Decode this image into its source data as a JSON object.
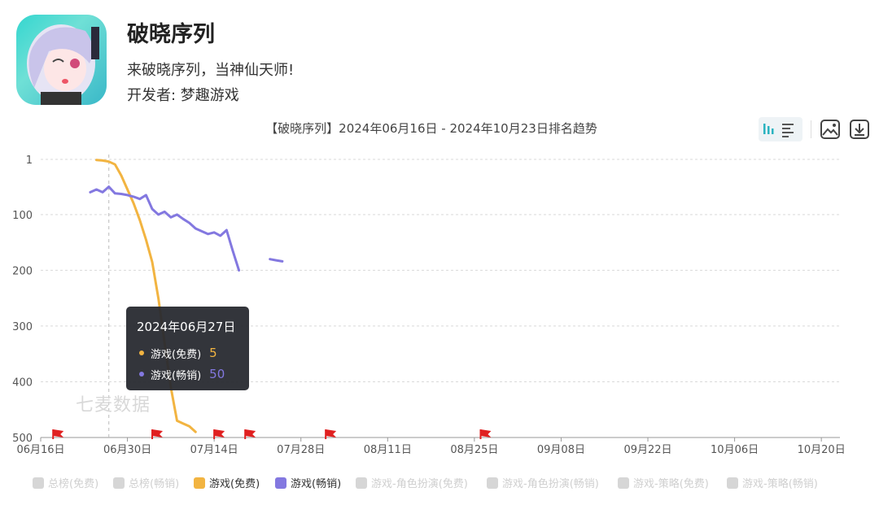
{
  "app": {
    "name": "破晓序列",
    "slogan": "来破晓序列，当神仙天师!",
    "developer_label": "开发者: ",
    "developer": "梦趣游戏"
  },
  "toolbar": {
    "icons": [
      "bar-chart-icon",
      "list-icon",
      "image-icon",
      "download-icon"
    ]
  },
  "watermark": "七麦数据",
  "tooltip": {
    "date": "2024年06月27日",
    "rows": [
      {
        "label": "游戏(免费)",
        "value": "5",
        "color": "#f2b441"
      },
      {
        "label": "游戏(畅销)",
        "value": "50",
        "color": "#8378e0"
      }
    ]
  },
  "chart_data": {
    "type": "line",
    "title": "【破晓序列】2024年06月16日 - 2024年10月23日排名趋势",
    "y_inverted": true,
    "ylim": [
      1,
      500
    ],
    "y_ticks": [
      "1",
      "100",
      "200",
      "300",
      "400",
      "500"
    ],
    "x_ticks": [
      "06月16日",
      "06月30日",
      "07月14日",
      "07月28日",
      "08月11日",
      "08月25日",
      "09月08日",
      "09月22日",
      "10月06日",
      "10月20日"
    ],
    "x_start": "2024-06-16",
    "x_end": "2024-10-23",
    "guide_date": "2024-06-27",
    "flags": [
      "2024-06-18",
      "2024-07-04",
      "2024-07-14",
      "2024-07-19",
      "2024-08-01",
      "2024-08-26"
    ],
    "legend": [
      {
        "label": "总榜(免费)",
        "active": false,
        "color": "#d6d6d6"
      },
      {
        "label": "总榜(畅销)",
        "active": false,
        "color": "#d6d6d6"
      },
      {
        "label": "游戏(免费)",
        "active": true,
        "color": "#f2b441"
      },
      {
        "label": "游戏(畅销)",
        "active": true,
        "color": "#8378e0"
      },
      {
        "label": "游戏-角色扮演(免费)",
        "active": false,
        "color": "#d6d6d6"
      },
      {
        "label": "游戏-角色扮演(畅销)",
        "active": false,
        "color": "#d6d6d6"
      },
      {
        "label": "游戏-策略(免费)",
        "active": false,
        "color": "#d6d6d6"
      },
      {
        "label": "游戏-策略(畅销)",
        "active": false,
        "color": "#d6d6d6"
      }
    ],
    "series": [
      {
        "name": "游戏(免费)",
        "color": "#f2b441",
        "points": [
          {
            "date": "2024-06-25",
            "y": 2
          },
          {
            "date": "2024-06-26",
            "y": 3
          },
          {
            "date": "2024-06-27",
            "y": 5
          },
          {
            "date": "2024-06-28",
            "y": 10
          },
          {
            "date": "2024-06-29",
            "y": 30
          },
          {
            "date": "2024-06-30",
            "y": 55
          },
          {
            "date": "2024-07-01",
            "y": 80
          },
          {
            "date": "2024-07-02",
            "y": 110
          },
          {
            "date": "2024-07-03",
            "y": 145
          },
          {
            "date": "2024-07-04",
            "y": 185
          },
          {
            "date": "2024-07-05",
            "y": 250
          },
          {
            "date": "2024-07-06",
            "y": 330
          },
          {
            "date": "2024-07-07",
            "y": 410
          },
          {
            "date": "2024-07-08",
            "y": 470
          },
          {
            "date": "2024-07-09",
            "y": 475
          },
          {
            "date": "2024-07-10",
            "y": 480
          },
          {
            "date": "2024-07-11",
            "y": 490
          }
        ]
      },
      {
        "name": "游戏(畅销)",
        "color": "#8378e0",
        "points": [
          {
            "date": "2024-06-24",
            "y": 60
          },
          {
            "date": "2024-06-25",
            "y": 55
          },
          {
            "date": "2024-06-26",
            "y": 60
          },
          {
            "date": "2024-06-27",
            "y": 50
          },
          {
            "date": "2024-06-28",
            "y": 62
          },
          {
            "date": "2024-06-29",
            "y": 63
          },
          {
            "date": "2024-06-30",
            "y": 65
          },
          {
            "date": "2024-07-01",
            "y": 68
          },
          {
            "date": "2024-07-02",
            "y": 72
          },
          {
            "date": "2024-07-03",
            "y": 65
          },
          {
            "date": "2024-07-04",
            "y": 90
          },
          {
            "date": "2024-07-05",
            "y": 100
          },
          {
            "date": "2024-07-06",
            "y": 95
          },
          {
            "date": "2024-07-07",
            "y": 105
          },
          {
            "date": "2024-07-08",
            "y": 100
          },
          {
            "date": "2024-07-09",
            "y": 108
          },
          {
            "date": "2024-07-10",
            "y": 115
          },
          {
            "date": "2024-07-11",
            "y": 125
          },
          {
            "date": "2024-07-12",
            "y": 130
          },
          {
            "date": "2024-07-13",
            "y": 135
          },
          {
            "date": "2024-07-14",
            "y": 132
          },
          {
            "date": "2024-07-15",
            "y": 138
          },
          {
            "date": "2024-07-16",
            "y": 128
          },
          {
            "date": "2024-07-17",
            "y": 165
          },
          {
            "date": "2024-07-18",
            "y": 200
          },
          null,
          {
            "date": "2024-07-23",
            "y": 180
          },
          {
            "date": "2024-07-24",
            "y": 182
          },
          {
            "date": "2024-07-25",
            "y": 184
          }
        ]
      }
    ]
  }
}
